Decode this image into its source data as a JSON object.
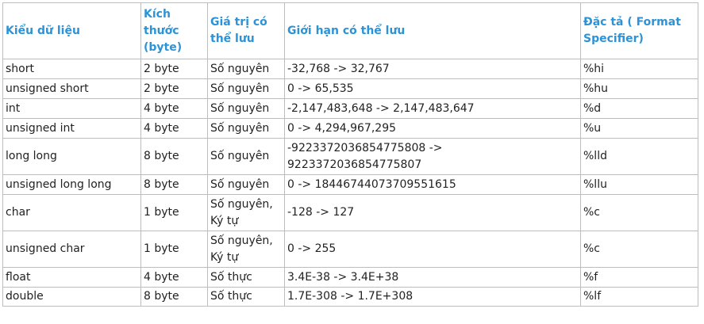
{
  "table": {
    "headers": [
      "Kiểu dữ liệu",
      "Kích thước (byte)",
      "Giá trị có thể lưu",
      "Giới hạn có thể lưu",
      "Đặc tả ( Format Specifier)"
    ],
    "rows": [
      [
        "short",
        "2 byte",
        "Số nguyên",
        "-32,768 -> 32,767",
        "%hi"
      ],
      [
        "unsigned short",
        "2 byte",
        "Số nguyên",
        "0 -> 65,535",
        "%hu"
      ],
      [
        "int",
        "4 byte",
        "Số nguyên",
        "-2,147,483,648 -> 2,147,483,647",
        "%d"
      ],
      [
        "unsigned int",
        "4 byte",
        "Số nguyên",
        "0 -> 4,294,967,295",
        "%u"
      ],
      [
        "long long",
        "8 byte",
        "Số nguyên",
        "-9223372036854775808 -> 9223372036854775807",
        "%lld"
      ],
      [
        "unsigned long long",
        "8 byte",
        "Số nguyên",
        "0 -> 18446744073709551615",
        "%llu"
      ],
      [
        "char",
        "1 byte",
        "Số nguyên, Ký tự",
        "-128 -> 127",
        "%c"
      ],
      [
        "unsigned char",
        "1 byte",
        "Số nguyên, Ký tự",
        "0 -> 255",
        "%c"
      ],
      [
        "float",
        "4 byte",
        "Số thực",
        "3.4E-38 -> 3.4E+38",
        "%f"
      ],
      [
        "double",
        "8 byte",
        "Số thực",
        "1.7E-308 -> 1.7E+308",
        "%lf"
      ]
    ]
  },
  "colors": {
    "header_text": "#2d93d6",
    "body_text": "#222222",
    "border": "#bdbdbd"
  }
}
